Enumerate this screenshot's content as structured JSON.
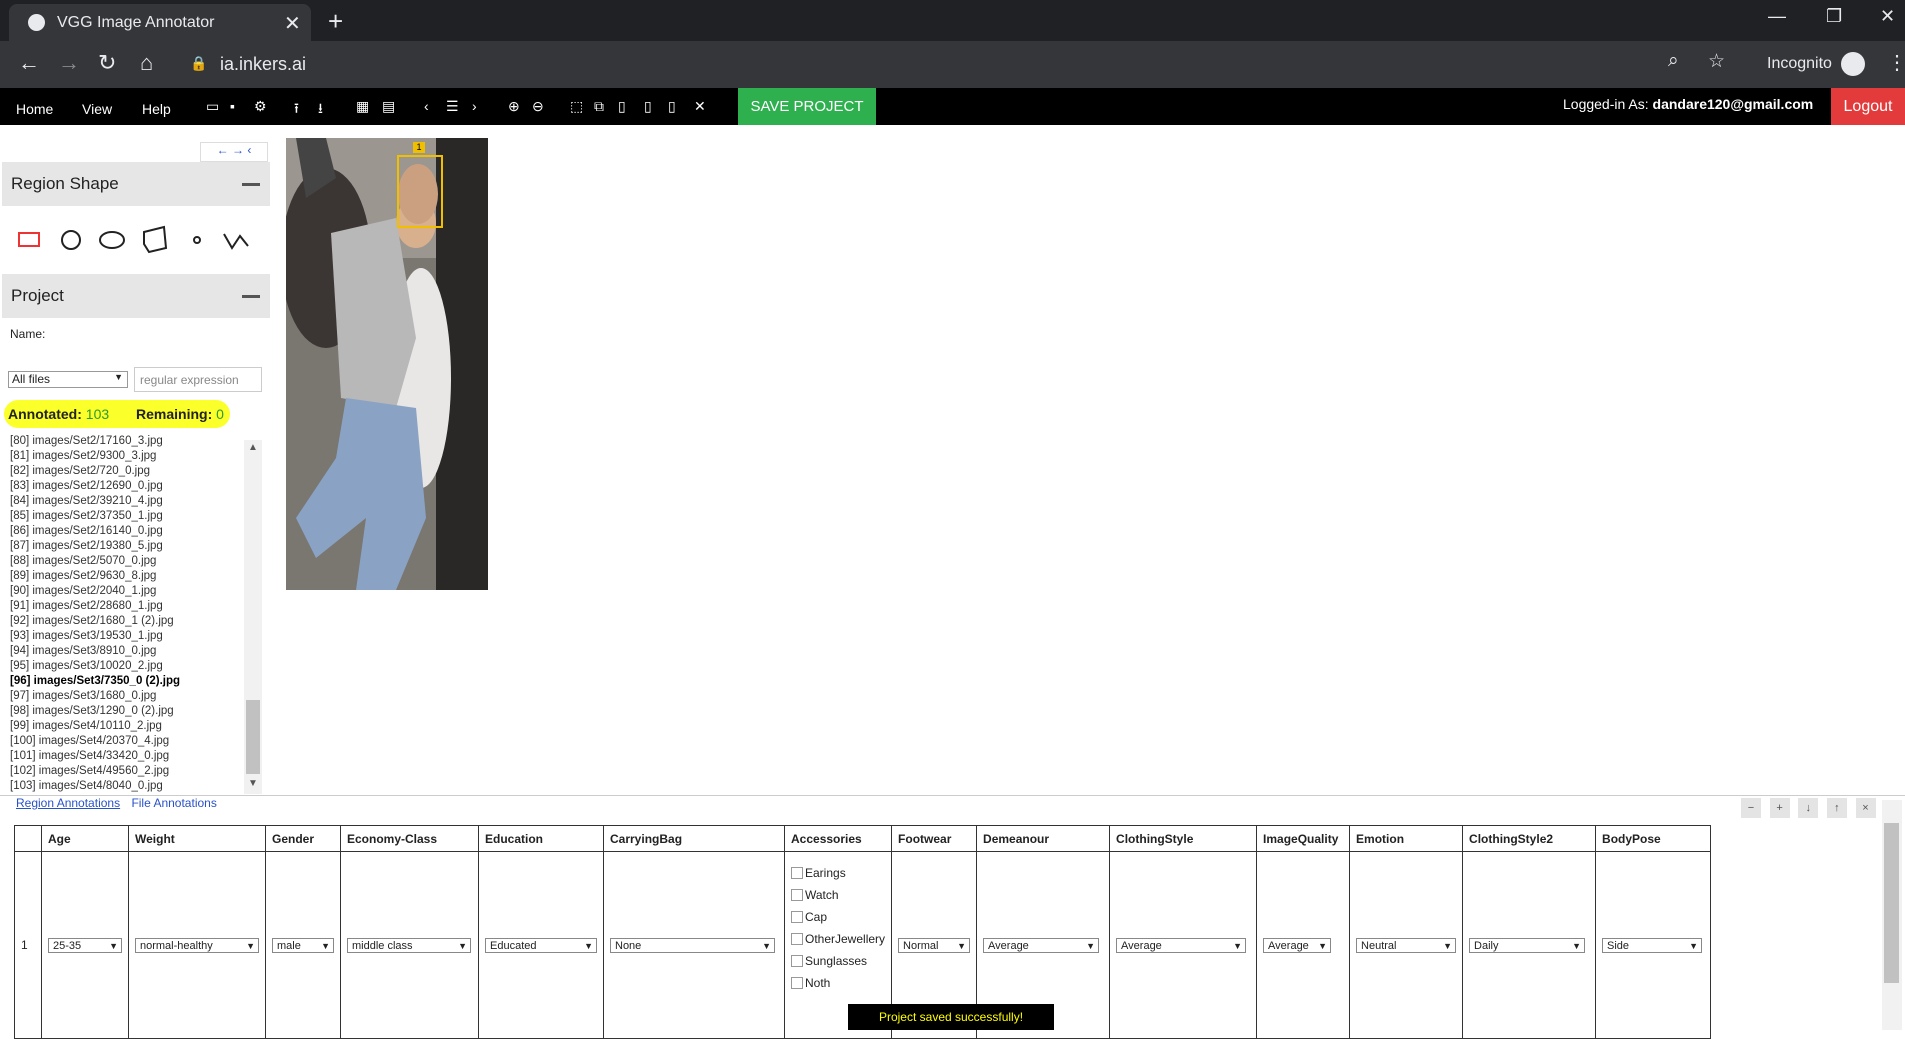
{
  "browser": {
    "tab_title": "VGG Image Annotator",
    "tab_close": "✕",
    "new_tab": "+",
    "url": "ia.inkers.ai",
    "incognito_label": "Incognito"
  },
  "app": {
    "menu": [
      "Home",
      "View",
      "Help"
    ],
    "save_project": "SAVE PROJECT",
    "logged_in_label": "Logged-in As:",
    "user_email": "dandare120@gmail.com",
    "logout": "Logout"
  },
  "left_panel": {
    "region_shape_title": "Region Shape",
    "project_title": "Project",
    "name_label": "Name:",
    "filter_value": "All files",
    "regex_placeholder": "regular expression",
    "annotated_label": "Annotated:",
    "annotated_value": "103",
    "remaining_label": "Remaining:",
    "remaining_value": "0",
    "files": [
      "[80] images/Set2/17160_3.jpg",
      "[81] images/Set2/9300_3.jpg",
      "[82] images/Set2/720_0.jpg",
      "[83] images/Set2/12690_0.jpg",
      "[84] images/Set2/39210_4.jpg",
      "[85] images/Set2/37350_1.jpg",
      "[86] images/Set2/16140_0.jpg",
      "[87] images/Set2/19380_5.jpg",
      "[88] images/Set2/5070_0.jpg",
      "[89] images/Set2/9630_8.jpg",
      "[90] images/Set2/2040_1.jpg",
      "[91] images/Set2/28680_1.jpg",
      "[92] images/Set2/1680_1 (2).jpg",
      "[93] images/Set3/19530_1.jpg",
      "[94] images/Set3/8910_0.jpg",
      "[95] images/Set3/10020_2.jpg",
      "[96] images/Set3/7350_0 (2).jpg",
      "[97] images/Set3/1680_0.jpg",
      "[98] images/Set3/1290_0 (2).jpg",
      "[99] images/Set4/10110_2.jpg",
      "[100] images/Set4/20370_4.jpg",
      "[101] images/Set4/33420_0.jpg",
      "[102] images/Set4/49560_2.jpg",
      "[103] images/Set4/8040_0.jpg"
    ],
    "current_file_index": 16
  },
  "canvas": {
    "region_label": "1"
  },
  "bottom": {
    "tabs": [
      "Region Annotations",
      "File Annotations"
    ],
    "row_index": "1",
    "columns": [
      "Age",
      "Weight",
      "Gender",
      "Economy-Class",
      "Education",
      "CarryingBag",
      "Accessories",
      "Footwear",
      "Demeanour",
      "ClothingStyle",
      "ImageQuality",
      "Emotion",
      "ClothingStyle2",
      "BodyPose"
    ],
    "values": {
      "Age": "25-35",
      "Weight": "normal-healthy",
      "Gender": "male",
      "Economy-Class": "middle class",
      "Education": "Educated",
      "CarryingBag": "None",
      "Footwear": "Normal",
      "Demeanour": "Average",
      "ClothingStyle": "Average",
      "ImageQuality": "Average",
      "Emotion": "Neutral",
      "ClothingStyle2": "Daily",
      "BodyPose": "Side"
    },
    "accessories": [
      "Earings",
      "Watch",
      "Cap",
      "OtherJewellery",
      "Sunglasses",
      "Noth"
    ],
    "toast": "Project saved successfully!"
  }
}
